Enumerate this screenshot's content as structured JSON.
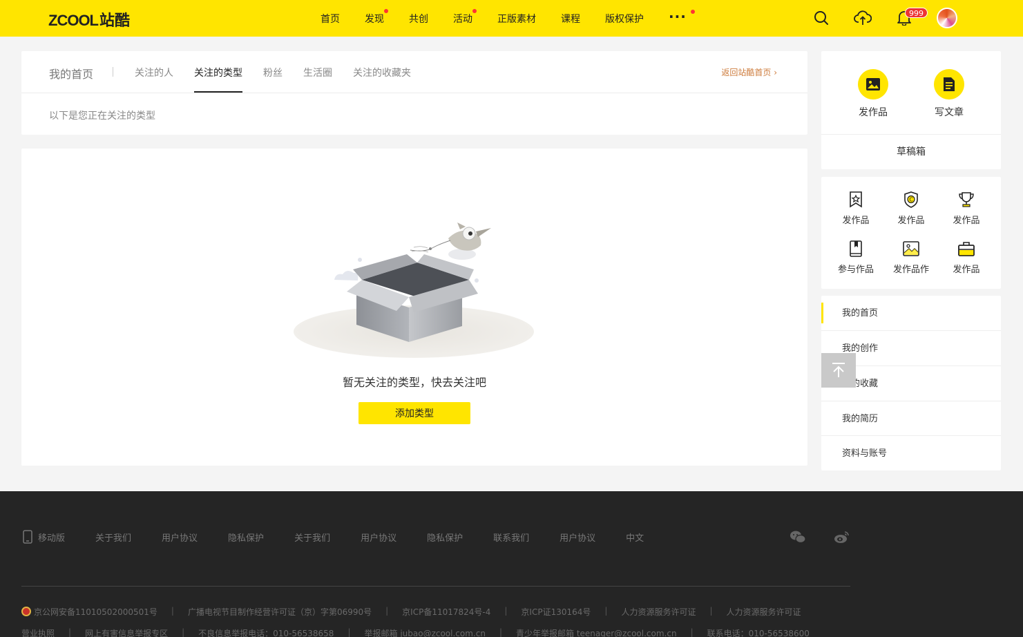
{
  "header": {
    "logo_text": "ZCOOL",
    "logo_cn": "站酷",
    "nav": [
      {
        "label": "首页",
        "dot": false
      },
      {
        "label": "发现",
        "dot": true
      },
      {
        "label": "共创",
        "dot": false
      },
      {
        "label": "活动",
        "dot": true
      },
      {
        "label": "正版素材",
        "dot": false
      },
      {
        "label": "课程",
        "dot": false
      },
      {
        "label": "版权保护",
        "dot": false
      }
    ],
    "more_label": "···",
    "notification_count": "999",
    "accent_color": "#ffe500"
  },
  "tabs": {
    "home_label": "我的首页",
    "items": [
      "关注的人",
      "关注的类型",
      "粉丝",
      "生活圈",
      "关注的收藏夹"
    ],
    "active": "关注的类型",
    "back_link": "返回站酷首页",
    "description": "以下是您正在关注的类型"
  },
  "empty": {
    "message": "暂无关注的类型，快去关注吧",
    "button_label": "添加类型"
  },
  "sidebar": {
    "actions": [
      {
        "label": "发作品",
        "icon": "image-icon"
      },
      {
        "label": "写文章",
        "icon": "document-icon"
      }
    ],
    "drafts_label": "草稿箱",
    "grid": [
      {
        "label": "发作品",
        "icon": "ribbon-star-icon"
      },
      {
        "label": "发作品",
        "icon": "copyright-shield-icon"
      },
      {
        "label": "发作品",
        "icon": "trophy-icon"
      },
      {
        "label": "参与作品",
        "icon": "book-icon"
      },
      {
        "label": "发作品作",
        "icon": "picture-icon"
      },
      {
        "label": "发作品",
        "icon": "briefcase-icon"
      }
    ],
    "menu": [
      "我的首页",
      "我的创作",
      "我的收藏",
      "我的简历",
      "资料与账号"
    ],
    "menu_active": "我的首页"
  },
  "footer": {
    "links": [
      "移动版",
      "关于我们",
      "用户协议",
      "隐私保护",
      "关于我们",
      "用户协议",
      "隐私保护",
      "联系我们",
      "用户协议",
      "中文"
    ],
    "row1": [
      "京公网安备110105020005​01号",
      "广播电视节目制作经营许可证（京）字第06990号",
      "京ICP备11017824号-4",
      "京ICP证130164号",
      "人力资源服务许可证",
      "人力资源服务许可证"
    ],
    "row2": [
      "营业执照",
      "网上有害信息举报专区",
      "不良信息举报电话：010-56538658",
      "举报邮箱 jubao@zcool.com.cn",
      "青少年举报邮箱 teenager@zcool.com.cn",
      "联系电话：010-56538600"
    ]
  }
}
